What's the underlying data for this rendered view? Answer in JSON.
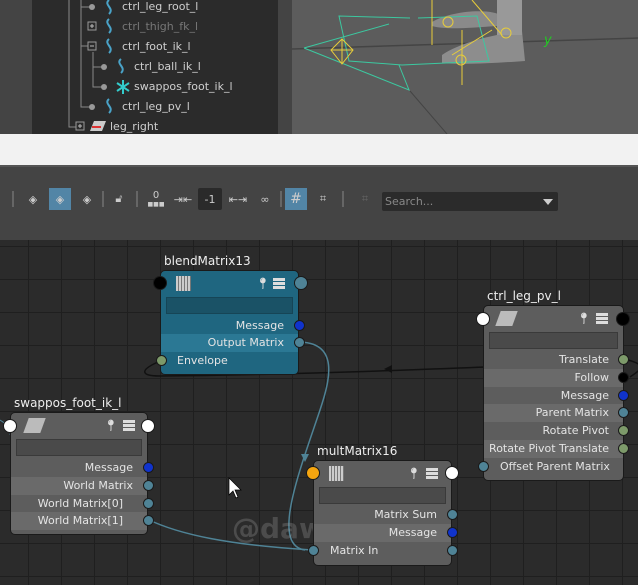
{
  "outliner": {
    "items": [
      {
        "label": "ctrl_leg_root_l",
        "icon": "nurbs-curve-icon",
        "expander": "none"
      },
      {
        "label": "ctrl_thigh_fk_l",
        "icon": "nurbs-curve-icon",
        "expander": "plus",
        "dimmed": true
      },
      {
        "label": "ctrl_foot_ik_l",
        "icon": "nurbs-curve-icon",
        "expander": "minus"
      },
      {
        "label": "ctrl_ball_ik_l",
        "icon": "nurbs-curve-icon",
        "expander": "none"
      },
      {
        "label": "swappos_foot_ik_l",
        "icon": "locator-icon",
        "expander": "none"
      },
      {
        "label": "ctrl_leg_pv_l",
        "icon": "nurbs-curve-icon",
        "expander": "none"
      },
      {
        "label": "leg_right",
        "icon": "transform-icon",
        "expander": "plus"
      }
    ]
  },
  "viewport": {
    "axis_label": "y"
  },
  "toolbar": {
    "frame_value_0": "0",
    "offset_value": "-1",
    "search_placeholder": "Search..."
  },
  "watermark": "@dawn_arc",
  "nodes": {
    "blend": {
      "title": "blendMatrix13",
      "rows": [
        "Message",
        "Output Matrix",
        "Envelope"
      ]
    },
    "pv": {
      "title": "ctrl_leg_pv_l",
      "rows": [
        "Translate",
        "Follow",
        "Message",
        "Parent Matrix",
        "Rotate Pivot",
        "Rotate Pivot Translate",
        "Offset Parent Matrix"
      ]
    },
    "swap": {
      "title": "swappos_foot_ik_l",
      "rows": [
        "Message",
        "World Matrix",
        "World Matrix[0]",
        "World Matrix[1]"
      ]
    },
    "mult": {
      "title": "multMatrix16",
      "rows": [
        "Matrix Sum",
        "Message",
        "Matrix In"
      ]
    }
  },
  "colors": {
    "matrix_port": "#4f8396",
    "message_port": "#1033cc",
    "vector_port": "#7d9a6a",
    "blend_node": "#1f6680",
    "selected_toolbar": "#5285a6"
  }
}
